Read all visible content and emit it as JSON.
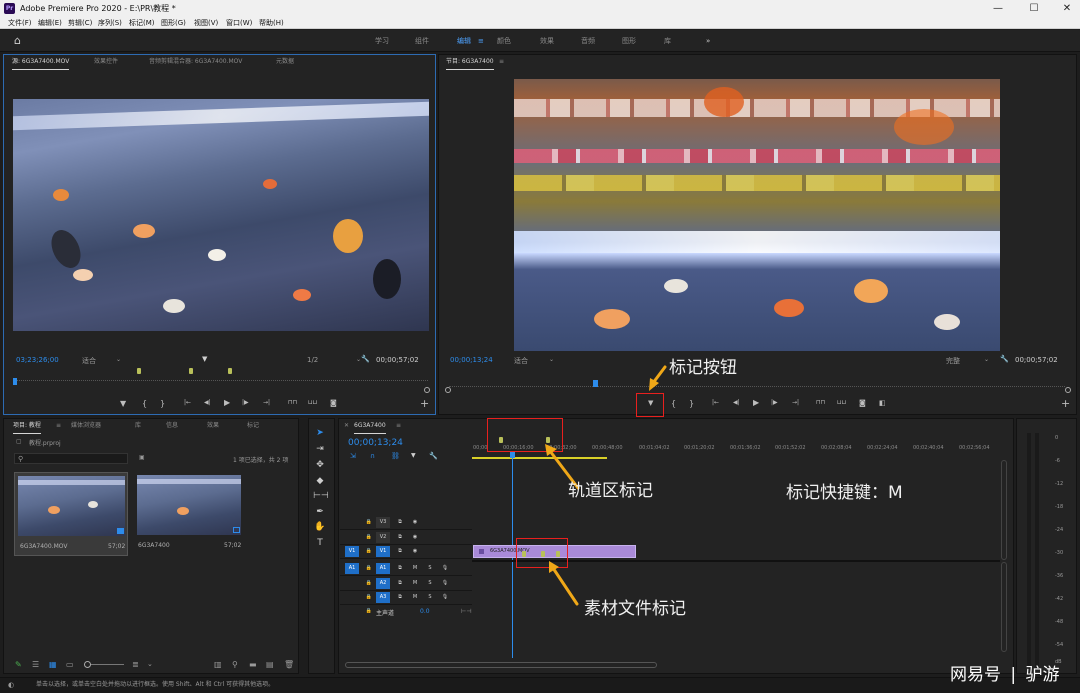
{
  "window": {
    "title": "Adobe Premiere Pro 2020 - E:\\PR\\教程 *",
    "icon": "Pr",
    "minimize": "—",
    "maximize": "☐",
    "close": "✕"
  },
  "menu": [
    "文件(F)",
    "编辑(E)",
    "剪辑(C)",
    "序列(S)",
    "标记(M)",
    "图形(G)",
    "视图(V)",
    "窗口(W)",
    "帮助(H)"
  ],
  "workspaces": {
    "items": [
      "学习",
      "组件",
      "编辑",
      "颜色",
      "效果",
      "音频",
      "图形",
      "库"
    ],
    "active": "编辑",
    "more": "»",
    "menu_glyph": "≡"
  },
  "source_monitor": {
    "tabs": [
      "源: 6G3A7400.MOV",
      "效果控件",
      "音频剪辑混合器: 6G3A7400.MOV",
      "元数据"
    ],
    "timecode": "03;23;26;00",
    "fit": "适合",
    "ratio": "1/2",
    "duration": "00;00;57;02"
  },
  "program_monitor": {
    "tab": "节目: 6G3A7400",
    "timecode": "00;00;13;24",
    "fit": "适合",
    "quality": "完整",
    "duration": "00;00;57;02"
  },
  "transport": {
    "marker": "▼",
    "in": "{",
    "out": "}",
    "goto_in": "|←",
    "step_back": "◀|",
    "play": "▶",
    "step_fwd": "|▶",
    "goto_out": "→|",
    "add": "+"
  },
  "project_panel": {
    "tabs": [
      "项目: 教程",
      "媒体浏览器",
      "库",
      "信息",
      "效果",
      "标记"
    ],
    "file": "教程.prproj",
    "selection": "1 项已选择，共 2 项",
    "items": [
      {
        "name": "6G3A7400.MOV",
        "duration": "57;02"
      },
      {
        "name": "6G3A7400",
        "duration": "57;02"
      }
    ]
  },
  "timeline": {
    "tab": "6G3A7400",
    "timecode": "00;00;13;24",
    "ruler": [
      "00;00",
      "00;00;16;00",
      "00;00;32;00",
      "00;00;48;00",
      "00;01;04;02",
      "00;01;20;02",
      "00;01;36;02",
      "00;01;52;02",
      "00;02;08;04",
      "00;02;24;04",
      "00;02;40;04",
      "00;02;56;04"
    ],
    "video_tracks": [
      "V3",
      "V2",
      "V1"
    ],
    "audio_tracks": [
      "A1",
      "A2",
      "A3"
    ],
    "source_patch_v": "V1",
    "source_patch_a": "A1",
    "master": "主声道",
    "master_value": "0.0",
    "clip_name": "6G3A7400.MOV",
    "mute": "M",
    "solo": "S"
  },
  "meter_scale": [
    "0",
    "-6",
    "-12",
    "-18",
    "-24",
    "-30",
    "-36",
    "-42",
    "-48",
    "-54",
    "dB"
  ],
  "status_bar": "单击以选择，或单击空白处并拖动以进行框选。使用 Shift、Alt 和 Ctrl 可获得其他选项。",
  "annotations": {
    "marker_button": "标记按钮",
    "track_marker": "轨道区标记",
    "shortcut": "标记快捷键：M",
    "clip_marker": "素材文件标记"
  },
  "watermark": {
    "brand": "网易号",
    "sep": "|",
    "author": "驴游"
  },
  "colors": {
    "accent_blue": "#2d8ceb",
    "clip_purple": "#a98ad8",
    "annotation_red": "#e8201e",
    "annotation_yellow": "#f0a818",
    "marker_green": "#b9c05a"
  }
}
